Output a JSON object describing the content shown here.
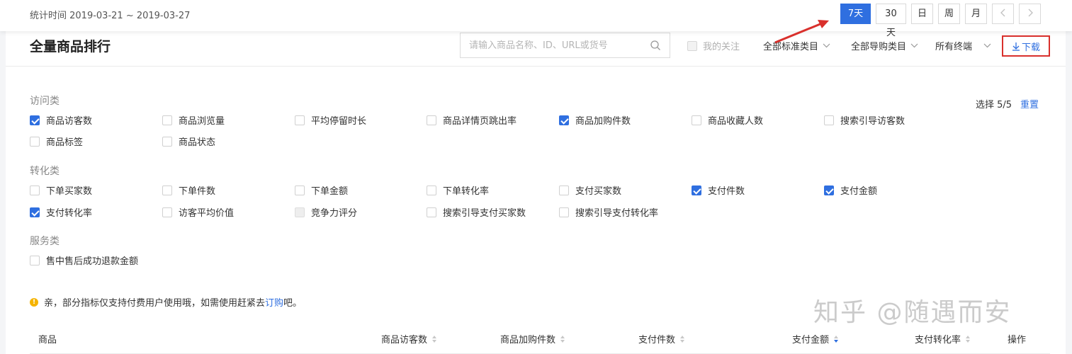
{
  "header": {
    "stat_time": "统计时间 2019-03-21 ~ 2019-03-27",
    "range_buttons": [
      "7天",
      "30天",
      "日",
      "周",
      "月"
    ],
    "prev_label": "‹",
    "next_label": "›"
  },
  "card": {
    "title": "全量商品排行",
    "search_placeholder": "请输入商品名称、ID、URL或货号",
    "my_follow": "我的关注",
    "dropdowns": [
      "全部标准类目",
      "全部导购类目",
      "所有终端"
    ],
    "download": "下载"
  },
  "metrics": {
    "select_count": "选择 5/5",
    "reset": "重置",
    "groups": [
      {
        "title": "访问类",
        "items": [
          {
            "label": "商品访客数",
            "checked": true
          },
          {
            "label": "商品浏览量",
            "checked": false
          },
          {
            "label": "平均停留时长",
            "checked": false
          },
          {
            "label": "商品详情页跳出率",
            "checked": false
          },
          {
            "label": "商品加购件数",
            "checked": true
          },
          {
            "label": "商品收藏人数",
            "checked": false
          },
          {
            "label": "搜索引导访客数",
            "checked": false
          },
          {
            "label": "商品标签",
            "checked": false
          },
          {
            "label": "商品状态",
            "checked": false
          }
        ]
      },
      {
        "title": "转化类",
        "items": [
          {
            "label": "下单买家数",
            "checked": false
          },
          {
            "label": "下单件数",
            "checked": false
          },
          {
            "label": "下单金额",
            "checked": false
          },
          {
            "label": "下单转化率",
            "checked": false
          },
          {
            "label": "支付买家数",
            "checked": false
          },
          {
            "label": "支付件数",
            "checked": true
          },
          {
            "label": "支付金额",
            "checked": true
          },
          {
            "label": "支付转化率",
            "checked": true
          },
          {
            "label": "访客平均价值",
            "checked": false
          },
          {
            "label": "竞争力评分",
            "checked": false,
            "disabled": true
          },
          {
            "label": "搜索引导支付买家数",
            "checked": false
          },
          {
            "label": "搜索引导支付转化率",
            "checked": false
          }
        ]
      },
      {
        "title": "服务类",
        "items": [
          {
            "label": "售中售后成功退款金额",
            "checked": false
          }
        ]
      }
    ]
  },
  "notice": {
    "icon": "!",
    "text": "亲，部分指标仅支持付费用户使用哦，如需使用赶紧去",
    "link": "订购",
    "suffix": "吧。"
  },
  "table": {
    "columns": [
      "商品",
      "商品访客数",
      "商品加购件数",
      "支付件数",
      "支付金额",
      "支付转化率",
      "操作"
    ]
  },
  "watermark": "知乎 @随遇而安",
  "colors": {
    "accent": "#2f6fe0",
    "annotation": "#d9302c",
    "warning": "#f5b400"
  }
}
